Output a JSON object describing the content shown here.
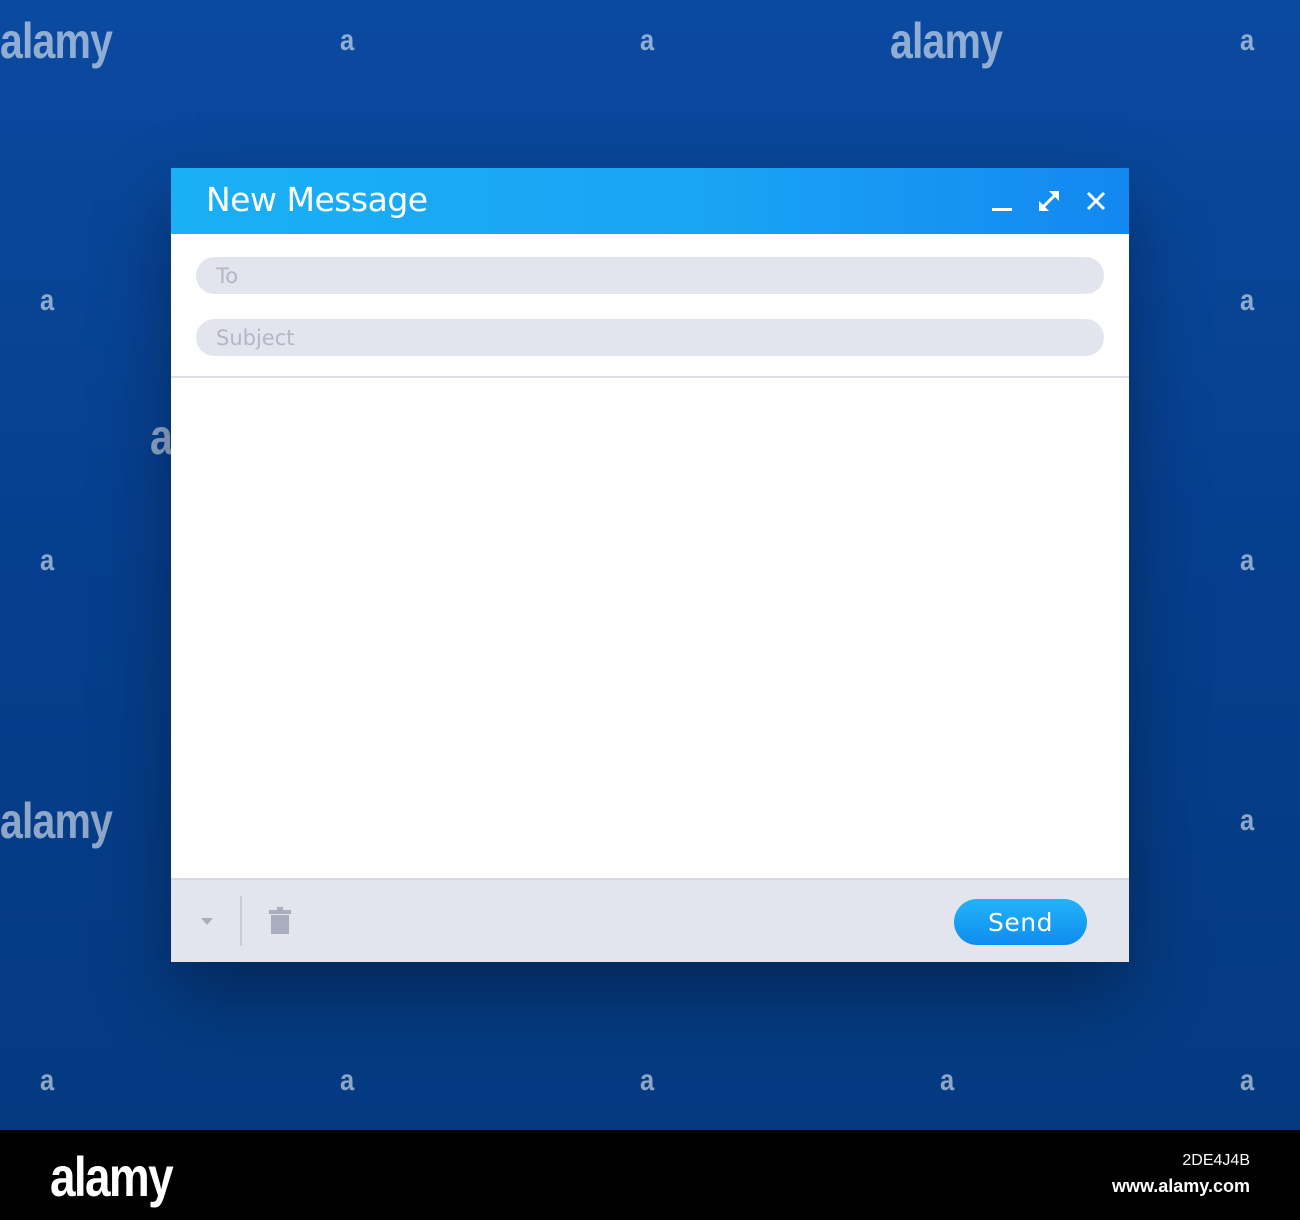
{
  "watermark": {
    "large": "alamy",
    "small": "a"
  },
  "window": {
    "title": "New Message",
    "controls": {
      "minimize": "minimize-icon",
      "maximize": "expand-icon",
      "close": "close-icon"
    }
  },
  "form": {
    "to_placeholder": "To",
    "to_value": "",
    "subject_placeholder": "Subject",
    "subject_value": "",
    "body_value": ""
  },
  "footer": {
    "dropdown_icon": "caret-down-icon",
    "delete_icon": "trash-icon",
    "send_label": "Send"
  },
  "stock_bar": {
    "logo": "alamy",
    "image_id": "2DE4J4B",
    "url": "www.alamy.com"
  },
  "colors": {
    "background": "#063f8f",
    "titlebar_start": "#1ab0f5",
    "titlebar_end": "#1288f0",
    "field_bg": "#e3e5ee",
    "send_button": "#1a9ff5"
  }
}
